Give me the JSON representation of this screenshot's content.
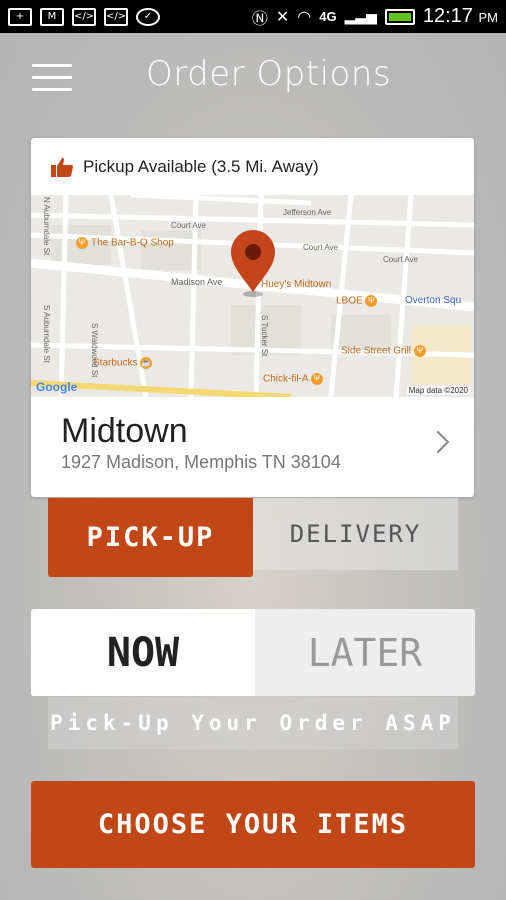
{
  "status_bar": {
    "time": "12:17",
    "ampm": "PM",
    "network": "4G",
    "icons": [
      "add-icon",
      "gmail-icon",
      "code-icon",
      "code-icon",
      "chat-icon",
      "nfc-icon",
      "mute-icon",
      "wifi-icon",
      "signal-icon",
      "battery-icon"
    ]
  },
  "header": {
    "title": "Order Options"
  },
  "location_card": {
    "availability": "Pickup Available (3.5 Mi. Away)",
    "store_name": "Midtown",
    "address": "1927 Madison, Memphis TN 38104",
    "map": {
      "streets": [
        "Jefferson Ave",
        "Court Ave",
        "Court Ave",
        "Court Ave",
        "Madison Ave",
        "N Auburndale St",
        "S Auburndale St",
        "S Waldwood St",
        "S Tucker St",
        "Overton Squ"
      ],
      "places": [
        "The Bar-B-Q Shop",
        "Huey's Midtown",
        "LBOE",
        "Side Street Grill",
        "Starbucks",
        "Chick-fil-A"
      ],
      "logo": "Google",
      "copyright": "Map data ©2020"
    }
  },
  "fulfillment": {
    "pickup_label": "PICK-UP",
    "delivery_label": "DELIVERY",
    "selected": "pickup"
  },
  "timing": {
    "now_label": "NOW",
    "later_label": "LATER",
    "selected": "now",
    "message": "Pick-Up Your Order ASAP"
  },
  "cta": {
    "label": "CHOOSE YOUR ITEMS"
  },
  "colors": {
    "accent": "#c14716",
    "pin": "#c4441c"
  }
}
